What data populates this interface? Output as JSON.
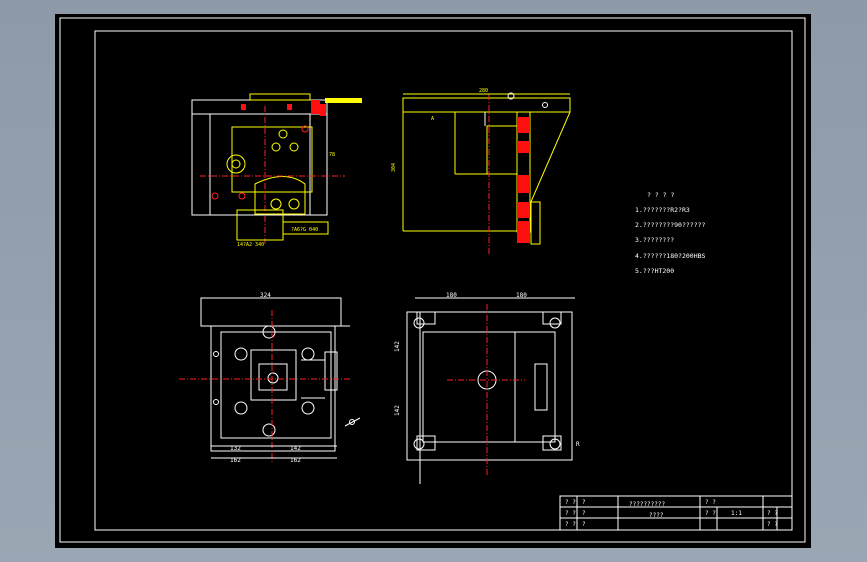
{
  "notes": {
    "heading": "? ? ? ?",
    "items": [
      "1.???????R2?R3",
      "2.????????90??????",
      "3.????????",
      "4.??????180?200HBS",
      "5.???HT200"
    ]
  },
  "dims": {
    "top_width": "324",
    "left_bottom_a": "132",
    "left_bottom_b": "142",
    "left_bottom_c": "162",
    "left_bottom_d": "162",
    "left_side": "140",
    "left_side_b": "142",
    "right_top_a": "180",
    "right_top_b": "180",
    "right_side_a": "142",
    "right_side_b": "142",
    "right_side_c": "37",
    "side_view_top": "280",
    "side_view_height": "304",
    "front_right_dim": "78",
    "front_bottom_label_a": "14?A2 340",
    "front_bottom_label_b": "?A6?G 040",
    "front_dim_a": "?",
    "side_label": "A",
    "right_angle_note": "R"
  },
  "title_block": {
    "name_row1": "??????????",
    "name_row2": "????",
    "r1c1": "? ?",
    "r1c2": "?",
    "r2c1": "? ?",
    "r2c2": "?",
    "r3c1": "? ?",
    "r3c2": "?",
    "r1c4": "? ?",
    "r2c4": "? ?",
    "r2c5": "1:1",
    "r1c7": "? ?",
    "r2c7": "? ?"
  }
}
